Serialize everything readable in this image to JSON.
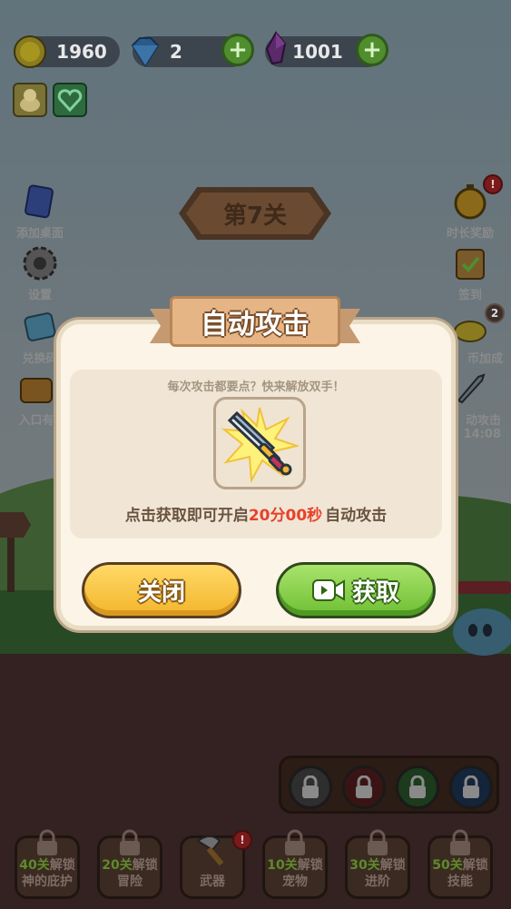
{
  "hud": {
    "gold": "1960",
    "diamonds": "2",
    "crystals": "1001",
    "plus": "+"
  },
  "left_menu": [
    {
      "label": "添加桌面",
      "icon": "card-shortcut-icon"
    },
    {
      "label": "设置",
      "icon": "gear-icon"
    },
    {
      "label": "兑换码",
      "icon": "gift-code-icon"
    },
    {
      "label": "入口有",
      "icon": "chest-icon"
    }
  ],
  "right_menu": [
    {
      "label": "时长奖励",
      "icon": "stopwatch-icon",
      "badge": "!"
    },
    {
      "label": "签到",
      "icon": "checkin-icon"
    },
    {
      "label": "币加成",
      "icon": "coin-boost-icon",
      "badge": "2"
    },
    {
      "label": "动攻击",
      "sub": "14:08",
      "icon": "sword-icon"
    }
  ],
  "level": {
    "label": "第7关"
  },
  "dialog": {
    "title": "自动攻击",
    "subtitle": "每次攻击都要点？快来解放双手！",
    "desc_prefix": "点击获取即可开启",
    "desc_highlight": "20分00秒",
    "desc_suffix": "自动攻击",
    "close_label": "关闭",
    "get_label": "获取"
  },
  "bottom_bar": [
    {
      "num": "40关",
      "unlock": "解锁",
      "label": "神的庇护"
    },
    {
      "num": "20关",
      "unlock": "解锁",
      "label": "冒险"
    },
    {
      "num": "",
      "unlock": "",
      "label": "武器",
      "badge": "!"
    },
    {
      "num": "10关",
      "unlock": "解锁",
      "label": "宠物"
    },
    {
      "num": "30关",
      "unlock": "解锁",
      "label": "进阶"
    },
    {
      "num": "50关",
      "unlock": "解锁",
      "label": "技能"
    }
  ],
  "colors": {
    "accent_red": "#e8402a",
    "button_yellow": "#f3b52a",
    "button_green": "#6fbf34"
  }
}
